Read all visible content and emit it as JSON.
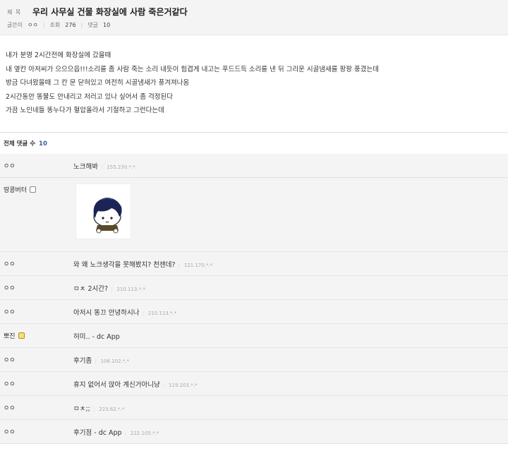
{
  "post": {
    "title_label": "제 목",
    "title": "우리 사무실 건물 화장실에 사람 죽은거같다",
    "author_label": "글쓴이",
    "author": "ㅇㅇ",
    "views_label": "조회",
    "views": "276",
    "comments_label": "댓글",
    "comments": "10",
    "lines": [
      "내가 분명 2시간전에 화장실에 갔을때",
      "내 옆칸 아저씨가 으으으읍!!!소리를 좀 사람 죽는 소리 내듯이 힘겹게 내고는 푸드드득 소리를 낸 뒤 그리운 시골냄새를 팡팡 풍겼는데",
      "방금 다녀왔을때 그 칸 문 닫혀있고 여전히 시골냄새가 풍겨져나옴",
      "2시간동안 똥물도 안내리고 저러고 있나 싶어서 좀 걱정된다",
      "가끔 노인네들 똥누다가 혈압올라서 기절하고 그런다는데"
    ]
  },
  "comments_header": {
    "label": "전체 댓글 수",
    "count": "10"
  },
  "comments": [
    {
      "author": "ㅇㅇ",
      "text": "노크해봐",
      "ip": "155.230.*.*",
      "badge": ""
    },
    {
      "author": "땅콩버터",
      "text": "",
      "ip": "",
      "badge": "gallog",
      "dccon": "character-sticker"
    },
    {
      "author": "ㅇㅇ",
      "text": "와 왜 노크생각을 못해봤지? 천잰데?",
      "ip": "121.170.*.*",
      "badge": ""
    },
    {
      "author": "ㅇㅇ",
      "text": "ㅁㅊ 2시간?",
      "ip": "210.113.*.*",
      "badge": ""
    },
    {
      "author": "ㅇㅇ",
      "text": "아저시 똥끄 안녕하시나",
      "ip": "210.113.*.*",
      "badge": ""
    },
    {
      "author": "뽀진",
      "text": "허미.. - dc App",
      "ip": "",
      "badge": "gold"
    },
    {
      "author": "ㅇㅇ",
      "text": "후기좀",
      "ip": "106.102.*.*",
      "badge": ""
    },
    {
      "author": "ㅇㅇ",
      "text": "휴지 없어서 앉아 계신거아니냥",
      "ip": "119.203.*.*",
      "badge": ""
    },
    {
      "author": "ㅇㅇ",
      "text": "ㅁㅊ;;",
      "ip": "223.62.*.*",
      "badge": ""
    },
    {
      "author": "ㅇㅇ",
      "text": "후기점 - dc App",
      "ip": "222.105.*.*",
      "badge": ""
    }
  ],
  "colors": {
    "accent": "#3b5ba5",
    "row_bg": "#f4f4f4"
  }
}
